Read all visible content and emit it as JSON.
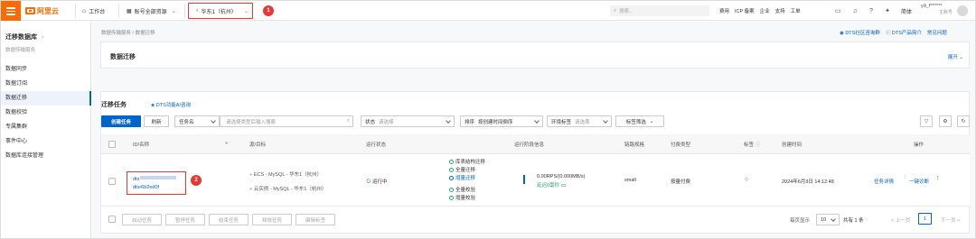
{
  "topbar": {
    "logo_text": "阿里云",
    "workbench": "工作台",
    "account": "账号全部资源",
    "region": "华东1（杭州）",
    "search_placeholder": "搜索...",
    "links": [
      "费用",
      "ICP 备案",
      "企业",
      "支持",
      "工单"
    ],
    "lang": "简体",
    "user_name": "yili_f*******",
    "user_role": "主账号"
  },
  "annotations": [
    "1",
    "2"
  ],
  "sidebar": {
    "title": "迁移数据库",
    "subtitle": "数据传输服务",
    "items": [
      {
        "label": "数据同步",
        "active": false
      },
      {
        "label": "数据订阅",
        "active": false
      },
      {
        "label": "数据迁移",
        "active": true
      },
      {
        "label": "数据校验",
        "active": false
      },
      {
        "label": "专属集群",
        "active": false
      },
      {
        "label": "事件中心",
        "active": false
      },
      {
        "label": "数据库连接管理",
        "active": false
      }
    ]
  },
  "breadcrumb": "数据传输服务 / 数据迁移",
  "header_links": [
    "DTS社区咨询群",
    "DTS产品简介",
    "常见问题"
  ],
  "migrate_card": {
    "title": "数据迁移",
    "expand": "展开"
  },
  "task_section": {
    "title": "迁移任务",
    "ai_link": "DTS功能AI咨询",
    "create_btn": "创建任务",
    "refresh_btn": "刷新",
    "task_name_select": "任务名",
    "search_placeholder": "请选择类型后输入搜索",
    "status_label": "状态",
    "status_placeholder": "请选择",
    "sort_label": "排序",
    "sort_value": "按创建时间倒序",
    "env_label": "环境标签",
    "env_placeholder": "请选择",
    "tag_filter": "标签筛选"
  },
  "table": {
    "headers": [
      "ID/名称",
      "源/目标",
      "运行状态",
      "运行阶段信息",
      "链路规格",
      "付费类型",
      "标签",
      "创建时间",
      "操作"
    ],
    "row": {
      "id_line1": "dts",
      "id_line2": "dtsr6b2ed0f",
      "source": "ECS - MySQL - 华东1（杭州）",
      "target": "云实例 - MySQL - 华东1（杭州）",
      "status": "运行中",
      "stages": [
        "库表结构迁移",
        "全量迁移",
        "增量迁移",
        "全量校验",
        "增量校验"
      ],
      "rps": "0.00RPS/(0.000MB/s)",
      "delay": "延迟0毫秒",
      "spec": "small",
      "pay": "按量付费",
      "created": "2024年6月3日 14:12:48",
      "actions": [
        "任务详情",
        "一键诊断"
      ]
    }
  },
  "footer": {
    "buttons": [
      "启动任务",
      "暂停任务",
      "结束任务",
      "释放任务",
      "编辑标签"
    ],
    "page_size_label": "每页显示",
    "page_size": "10",
    "total": "共有 1 条",
    "prev": "< 上一页",
    "page": "1",
    "next": "下一页 >"
  }
}
